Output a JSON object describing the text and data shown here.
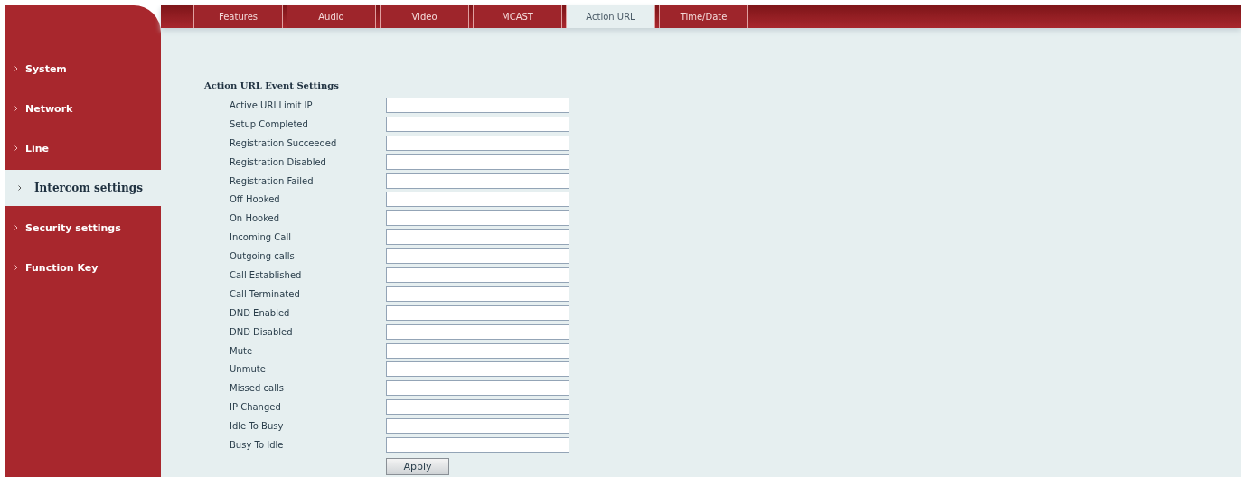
{
  "sidebar": {
    "items": [
      {
        "label": "System",
        "selected": false
      },
      {
        "label": "Network",
        "selected": false
      },
      {
        "label": "Line",
        "selected": false
      },
      {
        "label": "Intercom settings",
        "selected": true
      },
      {
        "label": "Security settings",
        "selected": false
      },
      {
        "label": "Function Key",
        "selected": false
      }
    ]
  },
  "tabs": [
    {
      "label": "Features",
      "selected": false
    },
    {
      "label": "Audio",
      "selected": false
    },
    {
      "label": "Video",
      "selected": false
    },
    {
      "label": "MCAST",
      "selected": false
    },
    {
      "label": "Action URL",
      "selected": true
    },
    {
      "label": "Time/Date",
      "selected": false
    }
  ],
  "section": {
    "title": "Action URL Event Settings",
    "fields": [
      {
        "label": "Active URI Limit IP"
      },
      {
        "label": "Setup Completed"
      },
      {
        "label": "Registration Succeeded"
      },
      {
        "label": "Registration Disabled"
      },
      {
        "label": "Registration Failed"
      },
      {
        "label": "Off Hooked"
      },
      {
        "label": "On Hooked"
      },
      {
        "label": "Incoming Call"
      },
      {
        "label": "Outgoing calls"
      },
      {
        "label": "Call Established"
      },
      {
        "label": "Call Terminated"
      },
      {
        "label": "DND Enabled"
      },
      {
        "label": "DND Disabled"
      },
      {
        "label": "Mute"
      },
      {
        "label": "Unmute"
      },
      {
        "label": "Missed calls"
      },
      {
        "label": "IP Changed"
      },
      {
        "label": "Idle To Busy"
      },
      {
        "label": "Busy To Idle"
      }
    ],
    "apply_button": "Apply"
  }
}
